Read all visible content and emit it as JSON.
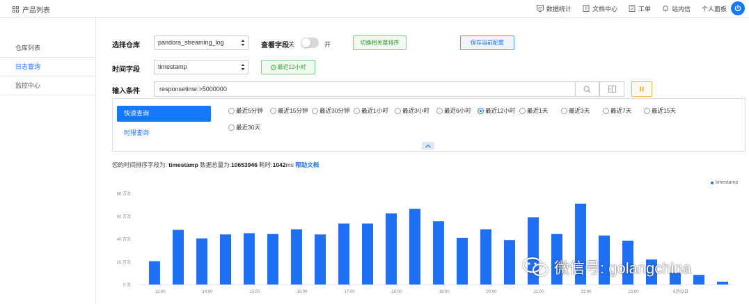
{
  "header": {
    "product_list": "产品列表",
    "nav": [
      {
        "label": "数据统计",
        "icon": "chart-window-icon"
      },
      {
        "label": "文档中心",
        "icon": "document-icon"
      },
      {
        "label": "工单",
        "icon": "clipboard-icon"
      },
      {
        "label": "站内信",
        "icon": "bell-icon"
      }
    ],
    "user_panel": "个人面板"
  },
  "sidebar": {
    "items": [
      {
        "label": "仓库列表",
        "active": false
      },
      {
        "label": "日志查询",
        "active": true
      },
      {
        "label": "监控中心",
        "active": false
      }
    ]
  },
  "form": {
    "repo_label": "选择仓库",
    "repo_value": "pandora_streaming_log",
    "view_fields_label": "查看字段",
    "toggle_off": "关",
    "toggle_on": "开",
    "sort_button": "切换相关度排序",
    "save_button": "保存当前配置",
    "time_field_label": "时间字段",
    "time_field_value": "timestamp",
    "recent_button": "最近12小时",
    "condition_label": "输入条件",
    "condition_value": "responsetime:>5000000"
  },
  "quick": {
    "quick_query": "快速查询",
    "time_query": "时限查询",
    "options": [
      "最近5分钟",
      "最近15分钟",
      "最近30分钟",
      "最近1小时",
      "最近3小时",
      "最近6小时",
      "最近12小时",
      "最近1天",
      "最近3天",
      "最近7天",
      "最近15天",
      "最近30天"
    ],
    "selected": "最近12小时"
  },
  "summary": {
    "prefix": "您的时间排序字段为:",
    "field": "timestamp",
    "total_label": "数据总量为:",
    "total": "10653946",
    "time_label": "耗时:",
    "time_value": "1042",
    "time_unit": "ms",
    "help_link": "帮助文档"
  },
  "chart_data": {
    "type": "bar",
    "legend": "timestamp",
    "yticks": [
      "0 次",
      "20 万次",
      "40 万次",
      "60 万次",
      "80 万次"
    ],
    "ylim": [
      0,
      80
    ],
    "xticks": [
      "13:00",
      "14:00",
      "15:00",
      "16:00",
      "17:00",
      "18:00",
      "19:00",
      "20:00",
      "21:00",
      "22:00",
      "23:00",
      "8月03日"
    ],
    "values": [
      20.5,
      48,
      40.5,
      44,
      45,
      44.5,
      48.5,
      44,
      53.5,
      53.5,
      62.5,
      66.5,
      55.5,
      41,
      48.5,
      39,
      59,
      44.5,
      71,
      43,
      38.5,
      22,
      10.5,
      8.5,
      2.5
    ],
    "color": "#1f6ff2"
  },
  "watermark": "微信号: golangchina"
}
